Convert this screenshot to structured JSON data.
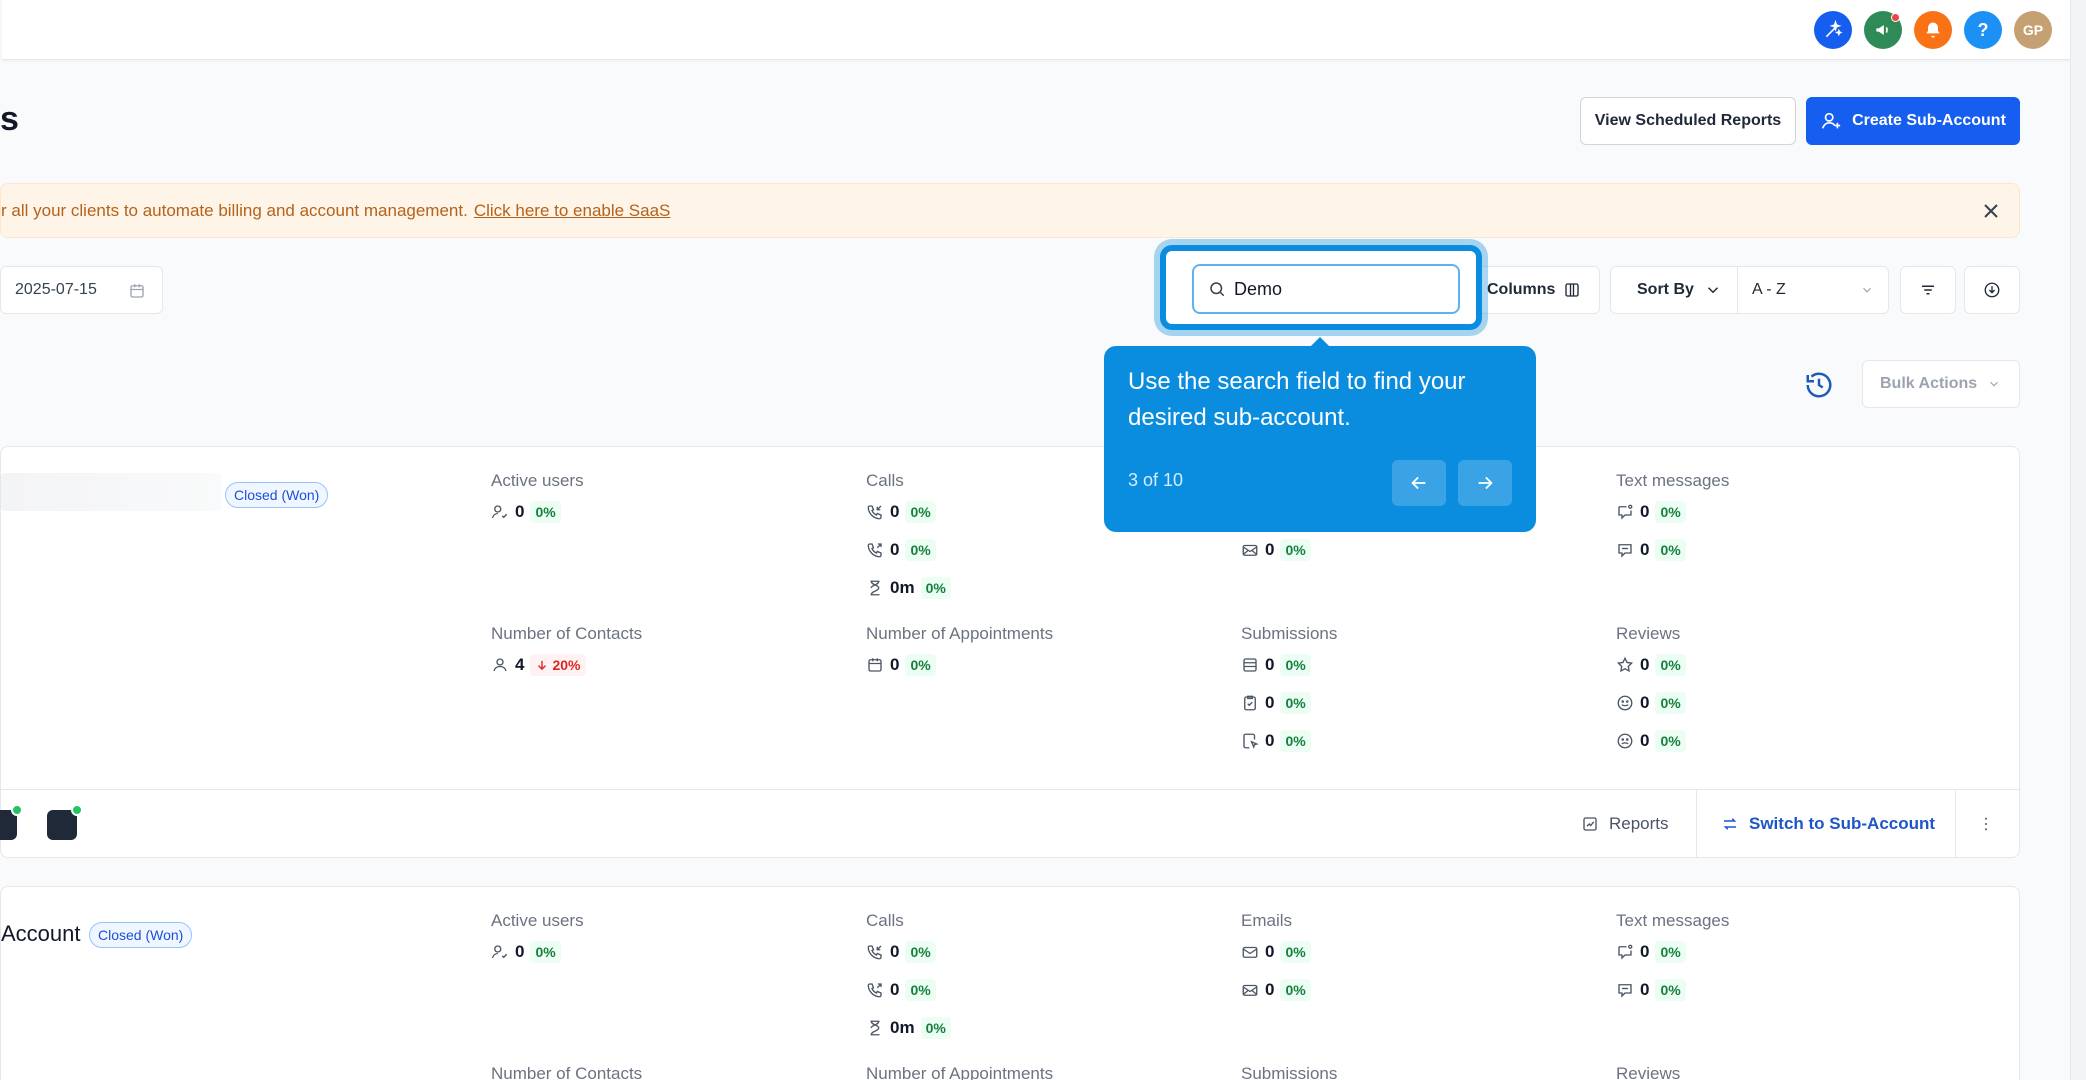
{
  "page": {
    "title_fragment": "s"
  },
  "topbar": {
    "icons": [
      {
        "name": "sparkle-icon",
        "color": "#155eef"
      },
      {
        "name": "megaphone-icon",
        "color": "#2e8b57"
      },
      {
        "name": "bell-icon",
        "color": "#f97316"
      },
      {
        "name": "help-icon",
        "color": "#1d90f5",
        "glyph": "?"
      },
      {
        "name": "avatar",
        "color": "#c5a073",
        "initials": "GP"
      }
    ]
  },
  "actions": {
    "view_scheduled_reports": "View Scheduled Reports",
    "create_sub_account": "Create Sub-Account"
  },
  "banner": {
    "text": "r all your clients to automate billing and account management.",
    "link": "Click here to enable SaaS"
  },
  "filters": {
    "date_end": "2025-07-15",
    "search_value": "Demo",
    "columns_label": "Columns",
    "sort_by_label": "Sort By",
    "sort_value": "A - Z"
  },
  "tour": {
    "text": "Use the search field to find your desired sub-account.",
    "step": "3 of 10"
  },
  "list_toolbar": {
    "bulk_actions": "Bulk Actions"
  },
  "card1": {
    "status": "Closed (Won)",
    "active_users": {
      "label": "Active users",
      "value": "0",
      "pct": "0%"
    },
    "calls": {
      "label": "Calls",
      "rows": [
        {
          "value": "0",
          "pct": "0%"
        },
        {
          "value": "0",
          "pct": "0%"
        },
        {
          "value": "0m",
          "pct": "0%"
        }
      ]
    },
    "emails": {
      "rows": [
        {
          "value": "0",
          "pct": "0%"
        }
      ]
    },
    "text_messages": {
      "label": "Text messages",
      "rows": [
        {
          "value": "0",
          "pct": "0%"
        },
        {
          "value": "0",
          "pct": "0%"
        }
      ]
    },
    "contacts": {
      "label": "Number of Contacts",
      "value": "4",
      "pct": "20%"
    },
    "appointments": {
      "label": "Number of Appointments",
      "value": "0",
      "pct": "0%"
    },
    "submissions": {
      "label": "Submissions",
      "rows": [
        {
          "value": "0",
          "pct": "0%"
        },
        {
          "value": "0",
          "pct": "0%"
        },
        {
          "value": "0",
          "pct": "0%"
        }
      ]
    },
    "reviews": {
      "label": "Reviews",
      "rows": [
        {
          "value": "0",
          "pct": "0%"
        },
        {
          "value": "0",
          "pct": "0%"
        },
        {
          "value": "0",
          "pct": "0%"
        }
      ]
    },
    "footer": {
      "reports": "Reports",
      "switch": "Switch to Sub-Account"
    }
  },
  "card2": {
    "title": "Account",
    "status": "Closed (Won)",
    "active_users": {
      "label": "Active users",
      "value": "0",
      "pct": "0%"
    },
    "calls": {
      "label": "Calls",
      "rows": [
        {
          "value": "0",
          "pct": "0%"
        },
        {
          "value": "0",
          "pct": "0%"
        },
        {
          "value": "0m",
          "pct": "0%"
        }
      ]
    },
    "emails": {
      "label": "Emails",
      "rows": [
        {
          "value": "0",
          "pct": "0%"
        },
        {
          "value": "0",
          "pct": "0%"
        }
      ]
    },
    "text_messages": {
      "label": "Text messages",
      "rows": [
        {
          "value": "0",
          "pct": "0%"
        },
        {
          "value": "0",
          "pct": "0%"
        }
      ]
    },
    "contacts_label": "Number of Contacts",
    "appointments_label": "Number of Appointments",
    "submissions_label": "Submissions",
    "reviews_label": "Reviews"
  }
}
